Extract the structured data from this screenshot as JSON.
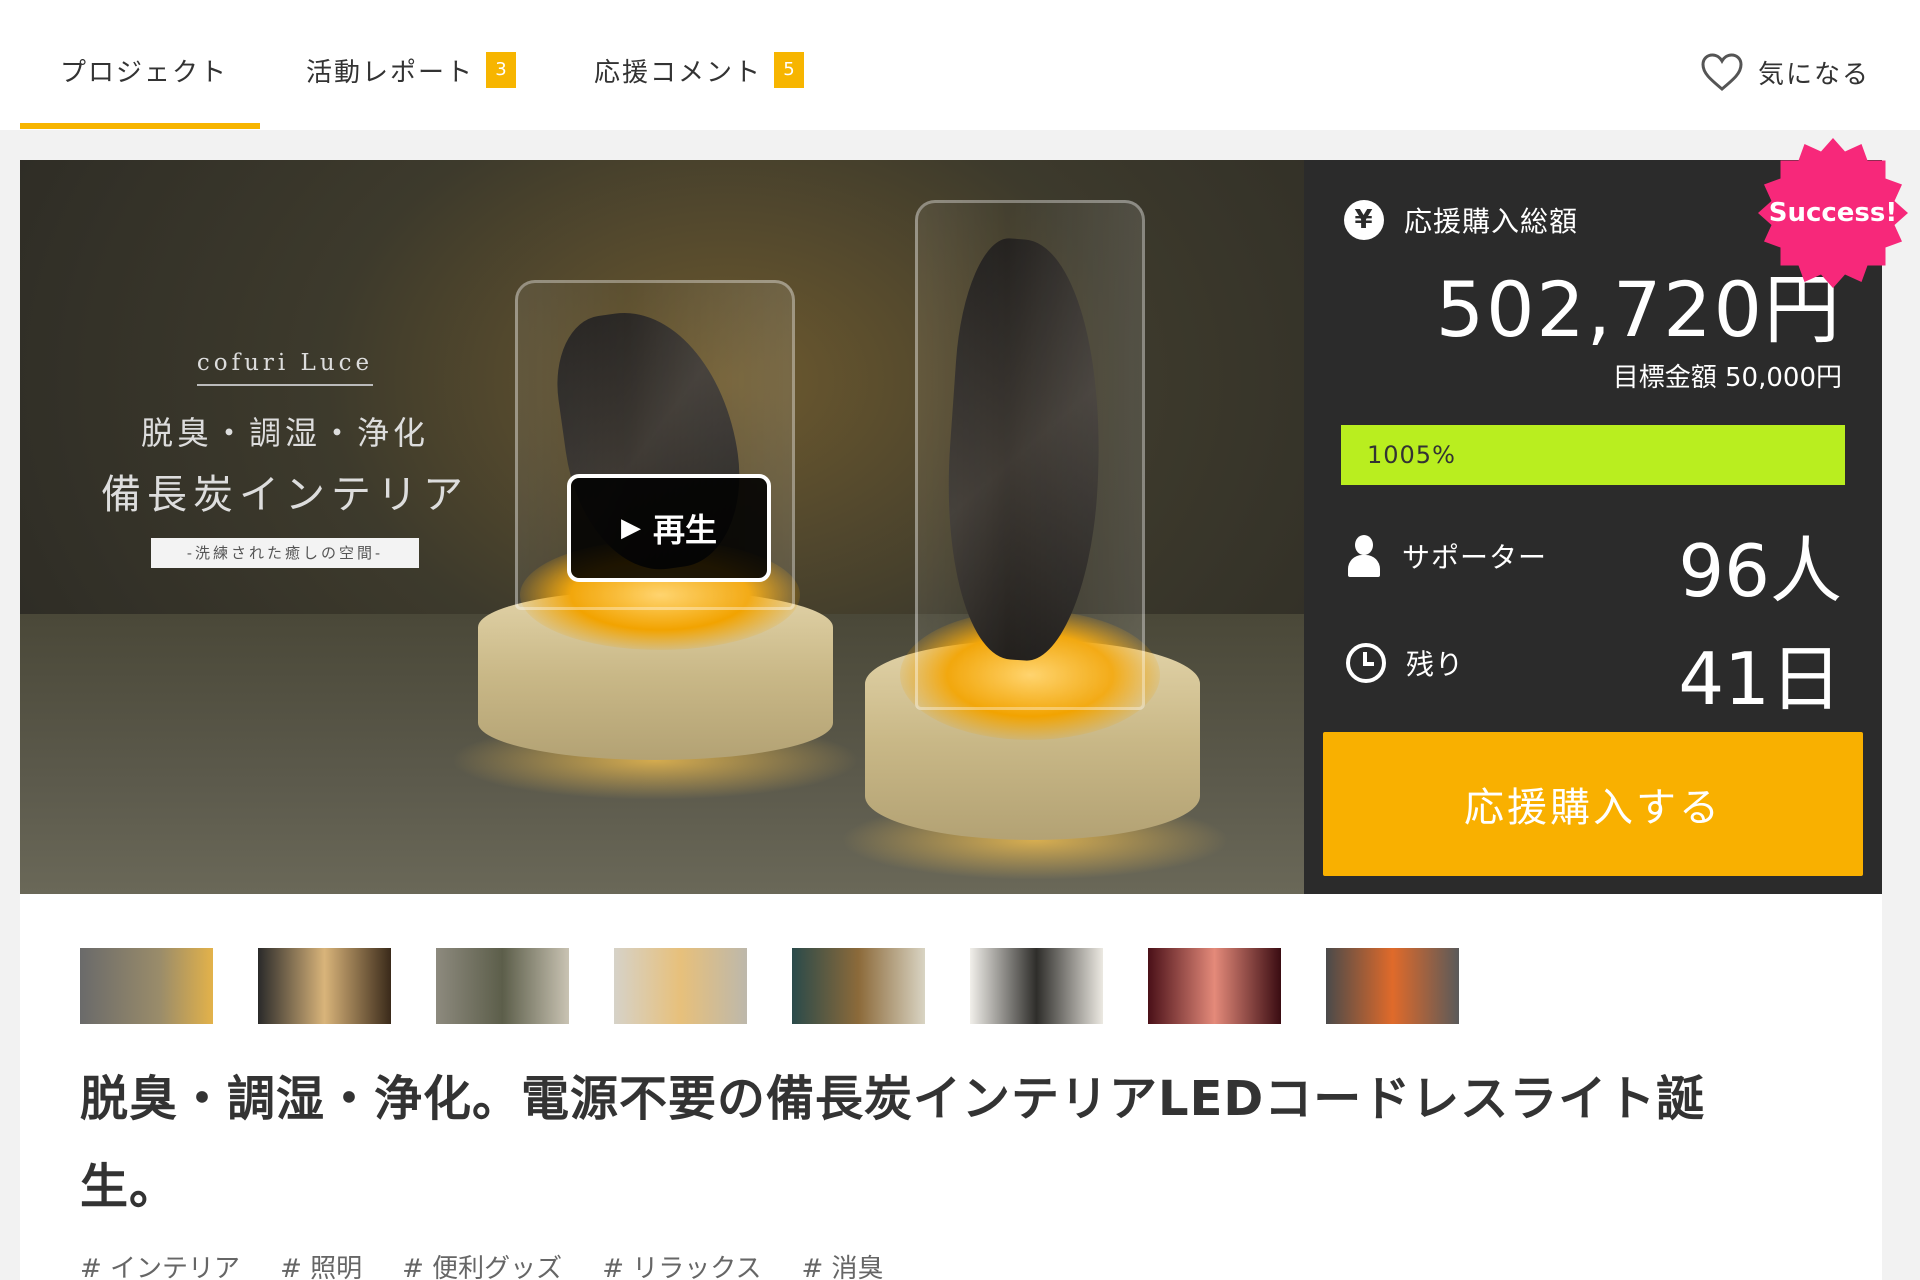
{
  "tabs": [
    {
      "label": "プロジェクト",
      "count": null
    },
    {
      "label": "活動レポート",
      "count": "3"
    },
    {
      "label": "応援コメント",
      "count": "5"
    }
  ],
  "favorite_label": "気になる",
  "hero": {
    "brand": "cofuri Luce",
    "subtitle": "脱臭・調湿・浄化",
    "main": "備長炭インテリア",
    "tagline": "-洗練された癒しの空間-",
    "play_label": "再生"
  },
  "stats": {
    "total_label": "応援購入総額",
    "total_icon_glyph": "¥",
    "total_amount": "502,720円",
    "goal": "目標金額 50,000円",
    "progress_text": "1005%",
    "progress_percent": 1005,
    "supporters_label": "サポーター",
    "supporters_value": "96人",
    "remaining_label": "残り",
    "remaining_value": "41日",
    "cta_label": "応援購入する",
    "success_badge": "Success!"
  },
  "thumbnails_count": 8,
  "title": "脱臭・調湿・浄化。電源不要の備長炭インテリアLEDコードレスライト誕生。",
  "tags": [
    "# インテリア",
    "# 照明",
    "# 便利グッズ",
    "# リラックス",
    "# 消臭"
  ],
  "colors": {
    "accent": "#f7b500",
    "progress": "#b9ee1f",
    "panel": "#2b2b2b",
    "success": "#f7287a"
  }
}
